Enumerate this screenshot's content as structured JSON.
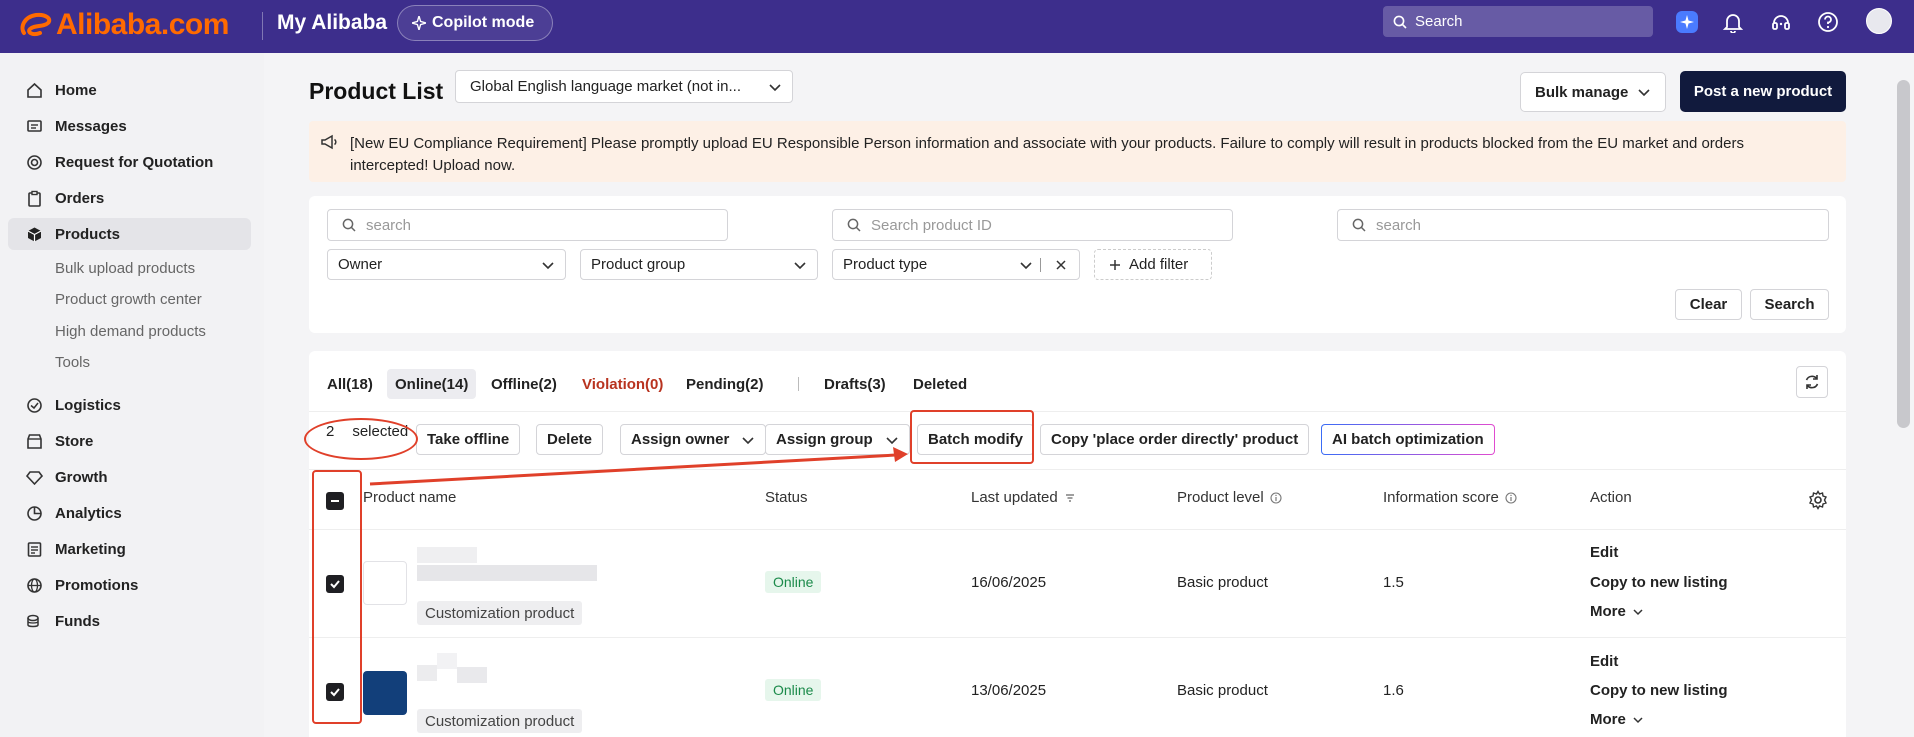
{
  "header": {
    "logo_text": "Alibaba.com",
    "section_title": "My Alibaba",
    "copilot_label": "Copilot mode",
    "search_placeholder": "Search",
    "brand_color": "#3d2e8c",
    "logo_color": "#ff6a00"
  },
  "sidebar": {
    "items": [
      {
        "label": "Home",
        "icon": "home-icon"
      },
      {
        "label": "Messages",
        "icon": "message-icon"
      },
      {
        "label": "Request for Quotation",
        "icon": "target-icon"
      },
      {
        "label": "Orders",
        "icon": "clipboard-icon"
      },
      {
        "label": "Products",
        "icon": "box-icon",
        "active": true
      },
      {
        "label": "Logistics",
        "icon": "logistics-icon"
      },
      {
        "label": "Store",
        "icon": "store-icon"
      },
      {
        "label": "Growth",
        "icon": "diamond-icon"
      },
      {
        "label": "Analytics",
        "icon": "pie-icon"
      },
      {
        "label": "Marketing",
        "icon": "marketing-icon"
      },
      {
        "label": "Promotions",
        "icon": "globe-icon"
      },
      {
        "label": "Funds",
        "icon": "funds-icon"
      }
    ],
    "sub_items": [
      "Bulk upload products",
      "Product growth center",
      "High demand products",
      "Tools"
    ]
  },
  "page": {
    "title": "Product List",
    "market_select": "Global English language market  (not in...",
    "bulk_manage": "Bulk manage",
    "post_product": "Post a new product"
  },
  "notice": {
    "text": "[New EU Compliance Requirement] Please promptly upload EU Responsible Person information and associate with your products. Failure to comply will result in products blocked from the EU market and orders intercepted! Upload now."
  },
  "filters": {
    "search1_placeholder": "search",
    "search2_placeholder": "Search product ID",
    "search3_placeholder": "search",
    "owner": "Owner",
    "product_group": "Product group",
    "product_type": "Product type",
    "add_filter": "Add filter",
    "clear": "Clear",
    "search": "Search"
  },
  "tabs": [
    {
      "label": "All(18)"
    },
    {
      "label": "Online(14)",
      "active": true
    },
    {
      "label": "Offline(2)"
    },
    {
      "label": "Violation(0)"
    },
    {
      "label": "Pending(2)"
    },
    {
      "label": "Drafts(3)"
    },
    {
      "label": "Deleted"
    }
  ],
  "actions": {
    "selected_count": "2",
    "selected_label": "selected",
    "take_offline": "Take offline",
    "delete": "Delete",
    "assign_owner": "Assign owner",
    "assign_group": "Assign group",
    "batch_modify": "Batch modify",
    "copy_place_order": "Copy 'place order directly' product",
    "ai_batch": "AI batch optimization"
  },
  "table": {
    "columns": [
      "Product name",
      "Status",
      "Last updated",
      "Product level",
      "Information score",
      "Action"
    ],
    "rows": [
      {
        "tag": "Customization product",
        "status": "Online",
        "last_updated": "16/06/2025",
        "level": "Basic product",
        "score": "1.5",
        "checked": true,
        "thumb_color": "#ffffff"
      },
      {
        "tag": "Customization product",
        "status": "Online",
        "last_updated": "13/06/2025",
        "level": "Basic product",
        "score": "1.6",
        "checked": true,
        "thumb_color": "#123f7a"
      }
    ],
    "row_actions": {
      "edit": "Edit",
      "copy": "Copy to new listing",
      "more": "More"
    }
  },
  "annotation_color": "#e0402a"
}
